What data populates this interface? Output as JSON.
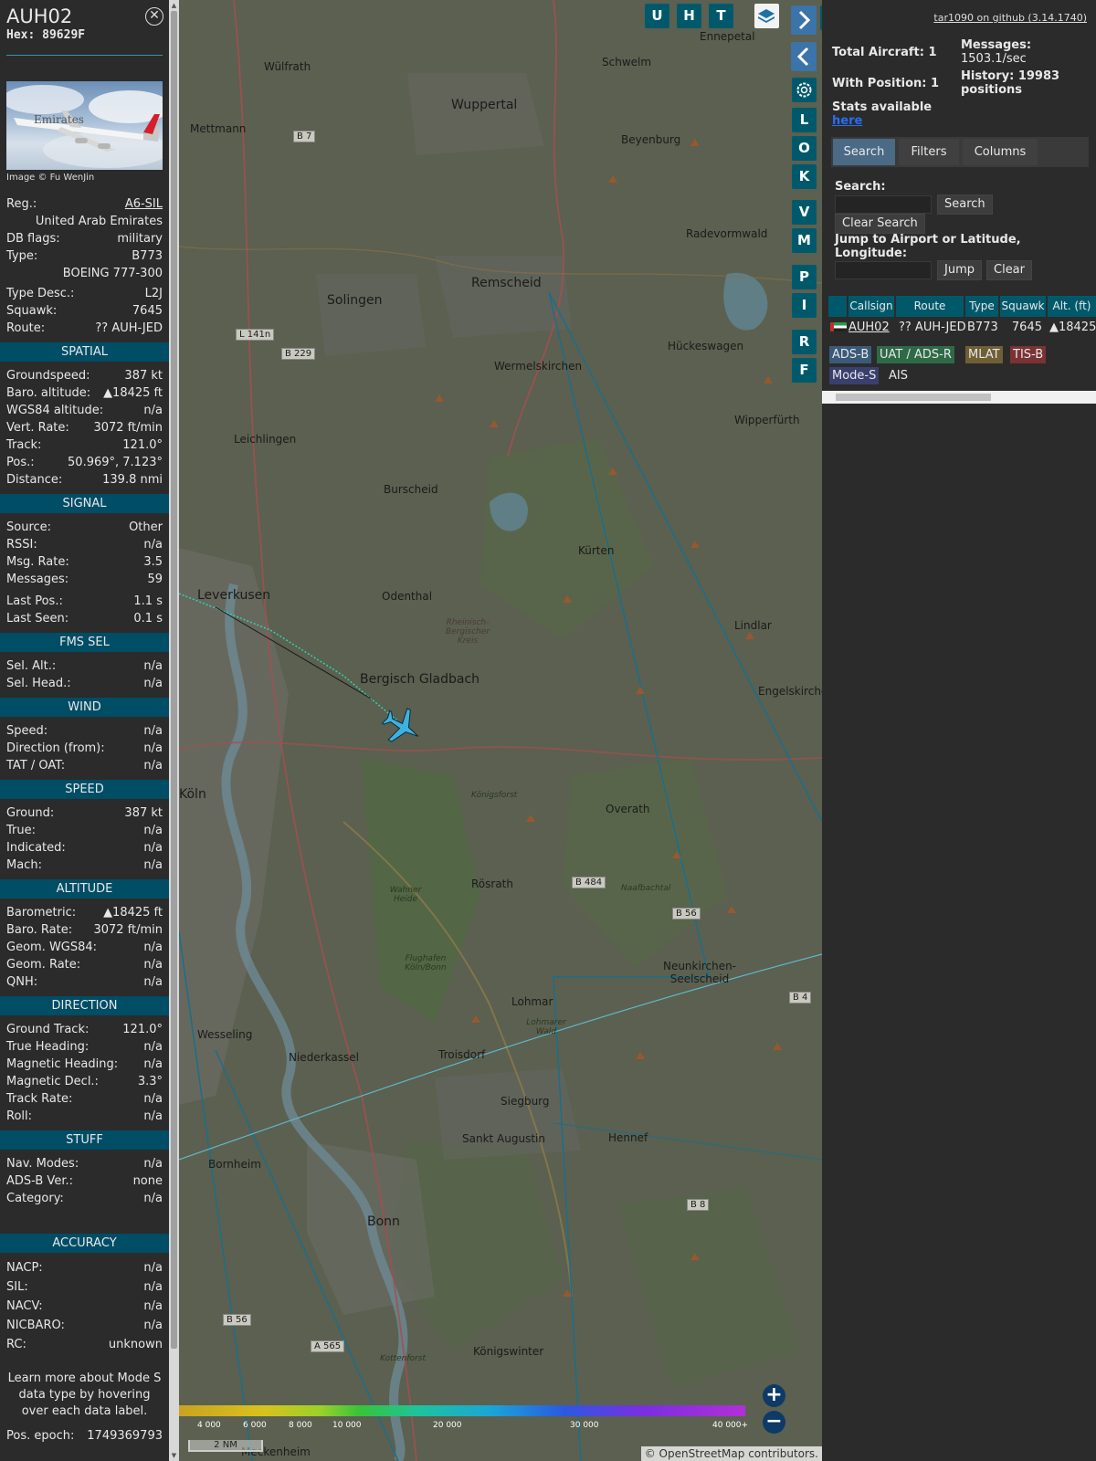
{
  "info": {
    "callsign": "AUH02",
    "hex": "Hex: 89629F",
    "photo_credit": "Image © Fu WenJin",
    "photo_text": "Emirates",
    "rows1": [
      {
        "k": "Reg.:",
        "v": "A6-SIL"
      },
      {
        "k": "",
        "v": "United Arab Emirates"
      },
      {
        "k": "DB flags:",
        "v": "military"
      },
      {
        "k": "Type:",
        "v": "B773"
      },
      {
        "k": "",
        "v": "BOEING 777-300"
      },
      {
        "k": "Type Desc.:",
        "v": "L2J"
      },
      {
        "k": "Squawk:",
        "v": "7645"
      },
      {
        "k": "Route:",
        "v": "?? AUH-JED"
      }
    ],
    "spatial_title": "SPATIAL",
    "spatial": [
      {
        "k": "Groundspeed:",
        "v": "387 kt"
      },
      {
        "k": "Baro. altitude:",
        "v": "▲18425 ft"
      },
      {
        "k": "WGS84 altitude:",
        "v": "n/a"
      },
      {
        "k": "Vert. Rate:",
        "v": "3072 ft/min"
      },
      {
        "k": "Track:",
        "v": "121.0°"
      },
      {
        "k": "Pos.:",
        "v": "50.969°, 7.123°"
      },
      {
        "k": "Distance:",
        "v": "139.8 nmi"
      }
    ],
    "signal_title": "SIGNAL",
    "signal": [
      {
        "k": "Source:",
        "v": "Other"
      },
      {
        "k": "RSSI:",
        "v": "n/a"
      },
      {
        "k": "Msg. Rate:",
        "v": "3.5"
      },
      {
        "k": "Messages:",
        "v": "59"
      },
      {
        "k": "Last Pos.:",
        "v": "1.1 s"
      },
      {
        "k": "Last Seen:",
        "v": "0.1 s"
      }
    ],
    "fms_title": "FMS SEL",
    "fms": [
      {
        "k": "Sel. Alt.:",
        "v": "n/a"
      },
      {
        "k": "Sel. Head.:",
        "v": "n/a"
      }
    ],
    "wind_title": "WIND",
    "wind": [
      {
        "k": "Speed:",
        "v": "n/a"
      },
      {
        "k": "Direction (from):",
        "v": "n/a"
      },
      {
        "k": "TAT / OAT:",
        "v": "n/a"
      }
    ],
    "speed_title": "SPEED",
    "speed": [
      {
        "k": "Ground:",
        "v": "387 kt"
      },
      {
        "k": "True:",
        "v": "n/a"
      },
      {
        "k": "Indicated:",
        "v": "n/a"
      },
      {
        "k": "Mach:",
        "v": "n/a"
      }
    ],
    "altitude_title": "ALTITUDE",
    "altitude": [
      {
        "k": "Barometric:",
        "v": "▲18425 ft"
      },
      {
        "k": "Baro. Rate:",
        "v": "3072 ft/min"
      },
      {
        "k": "Geom. WGS84:",
        "v": "n/a"
      },
      {
        "k": "Geom. Rate:",
        "v": "n/a"
      },
      {
        "k": "QNH:",
        "v": "n/a"
      }
    ],
    "direction_title": "DIRECTION",
    "direction": [
      {
        "k": "Ground Track:",
        "v": "121.0°"
      },
      {
        "k": "True Heading:",
        "v": "n/a"
      },
      {
        "k": "Magnetic Heading:",
        "v": "n/a"
      },
      {
        "k": "Magnetic Decl.:",
        "v": "3.3°"
      },
      {
        "k": "Track Rate:",
        "v": "n/a"
      },
      {
        "k": "Roll:",
        "v": "n/a"
      }
    ],
    "stuff_title": "STUFF",
    "stuff": [
      {
        "k": "Nav. Modes:",
        "v": "n/a"
      },
      {
        "k": "ADS-B Ver.:",
        "v": "none"
      },
      {
        "k": "Category:",
        "v": "n/a"
      }
    ],
    "accuracy_title": "ACCURACY",
    "accuracy": [
      {
        "k": "NACP:",
        "v": "n/a"
      },
      {
        "k": "SIL:",
        "v": "n/a"
      },
      {
        "k": "NACV:",
        "v": "n/a"
      },
      {
        "k": "NICBARO:",
        "v": "n/a"
      },
      {
        "k": "RC:",
        "v": "unknown"
      }
    ],
    "learn_more": "Learn more about Mode S data type by hovering over each data label.",
    "pos_epoch_label": "Pos. epoch:",
    "pos_epoch_value": "1749369793"
  },
  "map": {
    "places": [
      {
        "name": "Wülfrath"
      },
      {
        "name": "Wuppertal"
      },
      {
        "name": "Mettmann"
      },
      {
        "name": "Schwelm"
      },
      {
        "name": "Ennepetal"
      },
      {
        "name": "Beyenburg"
      },
      {
        "name": "Radevormwald"
      },
      {
        "name": "Remscheid"
      },
      {
        "name": "Solingen"
      },
      {
        "name": "Hückeswagen"
      },
      {
        "name": "Wermelskirchen"
      },
      {
        "name": "Wipperfürth"
      },
      {
        "name": "Leichlingen"
      },
      {
        "name": "Burscheid"
      },
      {
        "name": "Kürten"
      },
      {
        "name": "Leverkusen"
      },
      {
        "name": "Odenthal"
      },
      {
        "name": "Lindlar"
      },
      {
        "name": "Bergisch Gladbach"
      },
      {
        "name": "Engelskirchen"
      },
      {
        "name": "Köln"
      },
      {
        "name": "Overath"
      },
      {
        "name": "Rösrath"
      },
      {
        "name": "Neunkirchen-Seelscheid"
      },
      {
        "name": "Lohmar"
      },
      {
        "name": "Wesseling"
      },
      {
        "name": "Niederkassel"
      },
      {
        "name": "Troisdorf"
      },
      {
        "name": "Siegburg"
      },
      {
        "name": "Sankt Augustin"
      },
      {
        "name": "Hennef"
      },
      {
        "name": "Bornheim"
      },
      {
        "name": "Bonn"
      },
      {
        "name": "Königswinter"
      },
      {
        "name": "Königsforst"
      },
      {
        "name": "Wahner Heide"
      },
      {
        "name": "Flughafen Köln/Bonn"
      },
      {
        "name": "Rheinisch-Bergischer Kreis"
      },
      {
        "name": "Lohmarer Wald"
      },
      {
        "name": "Kottenforst"
      },
      {
        "name": "Naafbachtal"
      },
      {
        "name": "Meckenheim"
      }
    ],
    "road_labels": [
      "B 7",
      "L 141n",
      "B 229",
      "B 484",
      "B 56",
      "B 8",
      "B 56",
      "A 565",
      "B 4"
    ],
    "buttons": {
      "u": "U",
      "h": "H",
      "t": "T",
      "l": "L",
      "o": "O",
      "k": "K",
      "v": "V",
      "m": "M",
      "p": "P",
      "i": "I",
      "r": "R",
      "f": "F"
    },
    "zoom_in": "+",
    "zoom_out": "−",
    "scale": "2 NM",
    "attribution_prefix": "© ",
    "attribution_link": "OpenStreetMap",
    "attribution_suffix": " contributors.",
    "altitude_labels": [
      "4 000",
      "6 000",
      "8 000",
      "10 000",
      "20 000",
      "30 000",
      "40 000+"
    ]
  },
  "right": {
    "github": "tar1090 on github (3.14.1740)",
    "total_aircraft": "Total Aircraft: 1",
    "with_position": "With Position: 1",
    "messages_label": "Messages:",
    "messages_value": "1503.1/sec",
    "history": "History: 19983 positions",
    "stats_available": "Stats available",
    "stats_link": "here",
    "tabs": [
      "Search",
      "Filters",
      "Columns"
    ],
    "search_label": "Search:",
    "search_button": "Search",
    "clear_search": "Clear Search",
    "jump_label": "Jump to Airport or Latitude, Longitude:",
    "jump_button": "Jump",
    "clear_button": "Clear",
    "table": {
      "headers": [
        "Callsign",
        "Route",
        "Type",
        "Squawk",
        "Alt. (ft)"
      ],
      "row": {
        "callsign": "AUH02",
        "route": "?? AUH-JED",
        "type": "B773",
        "squawk": "7645",
        "alt": "▲18425"
      }
    },
    "legend": [
      {
        "label": "ADS-B",
        "color": "#3a5a78"
      },
      {
        "label": "UAT / ADS-R",
        "color": "#2e6a46"
      },
      {
        "label": "MLAT",
        "color": "#6e5f35"
      },
      {
        "label": "TIS-B",
        "color": "#7a3232"
      },
      {
        "label": "Mode-S",
        "color": "#3a3f6e"
      },
      {
        "label": "AIS",
        "color": "#2b2b2b"
      }
    ]
  }
}
